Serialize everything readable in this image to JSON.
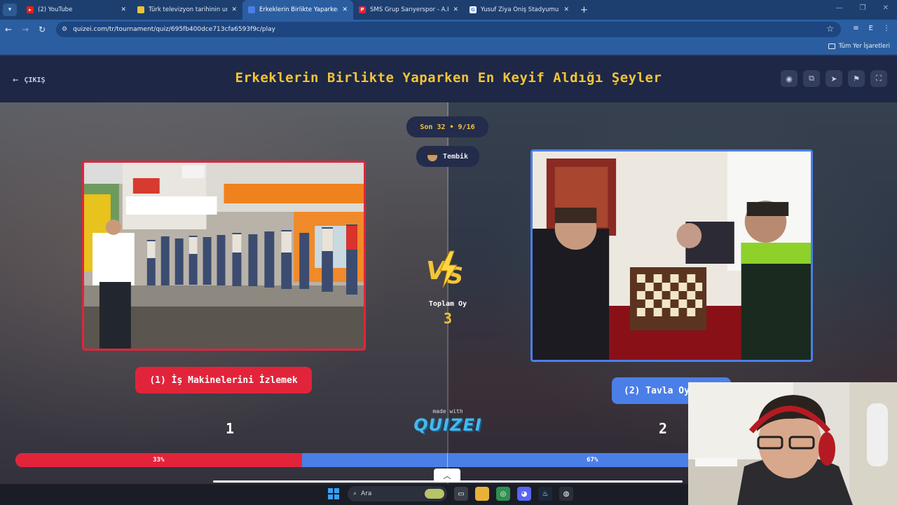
{
  "browser": {
    "tabs": [
      {
        "title": "(2) YouTube",
        "favicon_color": "#e62117",
        "active": false
      },
      {
        "title": "Türk televizyon tarihinin unutulmaz",
        "favicon_color": "#e8c33a",
        "active": false
      },
      {
        "title": "Erkeklerin Birlikte Yaparken En Keyif",
        "favicon_color": "#4b7fe8",
        "active": true
      },
      {
        "title": "SMS Grup Sarıyerspor - A.H. İğdır",
        "favicon_color": "#e2243b",
        "favicon_letter": "P",
        "active": false
      },
      {
        "title": "Yusuf Ziya Öniş Stadyumu - Google",
        "favicon_color": "#ffffff",
        "favicon_letter": "G",
        "active": false
      }
    ],
    "url": "quizei.com/tr/tournament/quiz/695fb400dce713cfa6593f9c/play",
    "profile_initial": "E",
    "bookmarks_all_label": "Tüm Yer İşaretleri"
  },
  "header": {
    "exit_label": "ÇIKIŞ",
    "title": "Erkeklerin Birlikte Yaparken En Keyif Aldığı Şeyler",
    "icons": [
      "eye-icon",
      "share-icon",
      "send-icon",
      "flag-icon",
      "fullscreen-icon"
    ]
  },
  "match": {
    "round_label": "Son 32 • 9/16",
    "tag_label": "Tembik",
    "total_label": "Toplam Oy",
    "total_votes": "3",
    "left": {
      "label": "(1) İş Makinelerini İzlemek",
      "votes": "1",
      "percent": "33%",
      "percent_value": 33
    },
    "right": {
      "label": "(2) Tavla Oy",
      "votes": "2",
      "percent": "67%",
      "percent_value": 67
    },
    "made_with": "made with",
    "brand": "QUIZEI"
  },
  "taskbar": {
    "search_placeholder": "Ara"
  },
  "colors": {
    "accent_yellow": "#f3c536",
    "left_red": "#e2243b",
    "right_blue": "#4b7fe8",
    "header_bg": "#1e2746"
  }
}
